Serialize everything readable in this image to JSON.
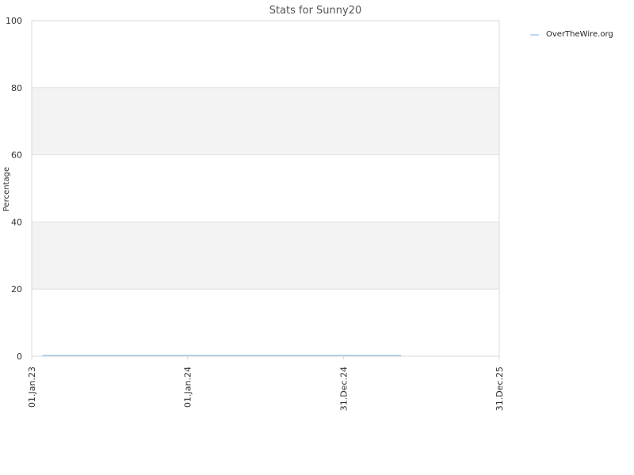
{
  "chart_data": {
    "type": "line",
    "title": "Stats for Sunny20",
    "xlabel": "",
    "ylabel": "Percentage",
    "ylim": [
      0,
      100
    ],
    "yticks": [
      0,
      20,
      40,
      60,
      80,
      100
    ],
    "x_range": [
      "2023-01-01",
      "2025-12-31"
    ],
    "xticks": [
      {
        "date": "2023-01-01",
        "label": "01.Jan.23"
      },
      {
        "date": "2024-01-01",
        "label": "01.Jan.24"
      },
      {
        "date": "2024-12-31",
        "label": "31.Dec.24"
      },
      {
        "date": "2025-12-31",
        "label": "31.Dec.25"
      }
    ],
    "grid": "horizontal alternating bands",
    "legend_position": "top-right",
    "series": [
      {
        "name": "OverTheWire.org",
        "color": "#a6c8e8",
        "points": [
          {
            "x": "2023-01-26",
            "y": 0
          },
          {
            "x": "2025-05-15",
            "y": 0
          }
        ]
      }
    ]
  }
}
